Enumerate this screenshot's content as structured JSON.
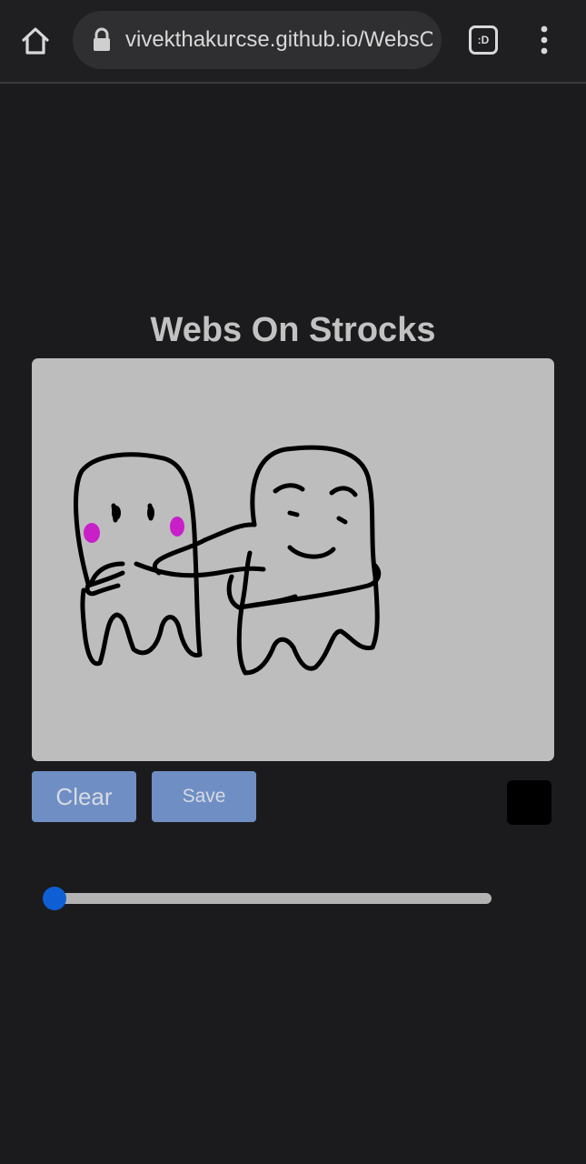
{
  "browser": {
    "url": "vivekthakurcse.github.io/WebsOnStrocks/",
    "tab_count": ":D"
  },
  "app": {
    "title": "Webs On Strocks"
  },
  "controls": {
    "clear_label": "Clear",
    "save_label": "Save",
    "brush_color": "#000000",
    "brush_size": 0.02
  },
  "colors": {
    "background": "#1b1b1d",
    "canvas": "#bdbdbd",
    "button": "#6f8ec4",
    "slider_thumb": "#0e5fd3",
    "blush": "#c81fc8"
  }
}
